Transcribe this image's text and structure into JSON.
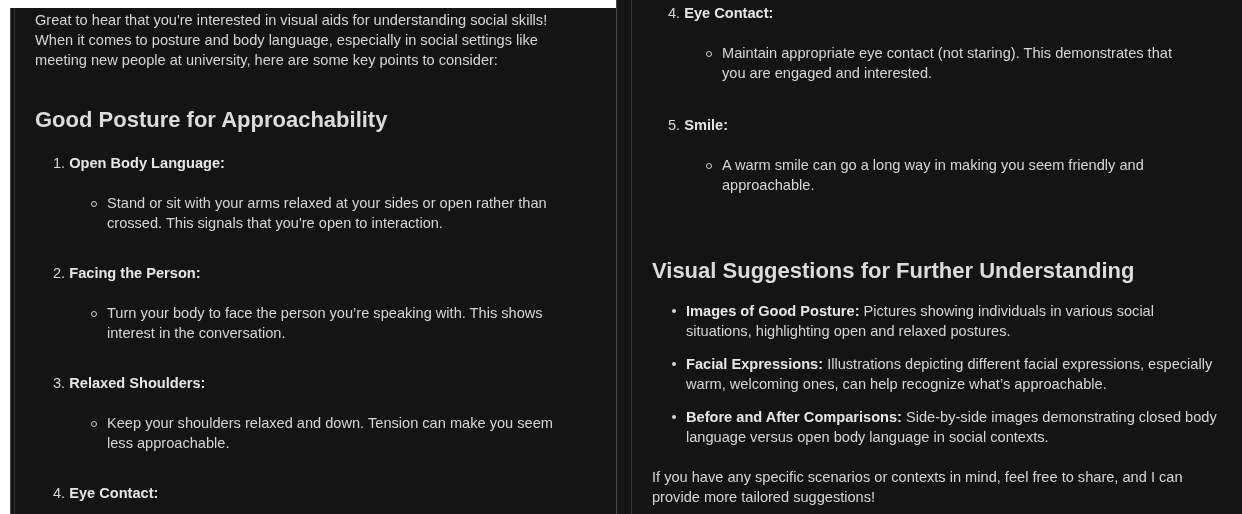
{
  "left_panel": {
    "intro": "Great to hear that you're interested in visual aids for understanding social skills! When it comes to posture and body language, especially in social settings like meeting new people at university, here are some key points to consider:",
    "heading": "Good Posture for Approachability",
    "items": [
      {
        "title": "1. **Open Body Language:**",
        "bullets": [
          "Stand or sit with your arms relaxed at your sides or open rather than crossed. This signals that you're open to interaction."
        ]
      },
      {
        "title": "2. **Facing the Person:**",
        "bullets": [
          "Turn your body to face the person you’re speaking with. This shows interest in the conversation."
        ]
      },
      {
        "title": "3. **Relaxed Shoulders:**",
        "bullets": [
          "Keep your shoulders relaxed and down. Tension can make you seem less approachable."
        ]
      },
      {
        "title": "4. **Eye Contact:**"
      }
    ]
  },
  "right_panel": {
    "items": [
      {
        "title": "4. **Eye Contact:**",
        "bullets": [
          "Maintain appropriate eye contact (not staring). This demonstrates that you are engaged and interested."
        ]
      },
      {
        "title": "5. **Smile:**",
        "bullets": [
          "A warm smile can go a long way in making you seem friendly and approachable."
        ]
      }
    ],
    "heading": "Visual Suggestions for Further Understanding",
    "suggestions": [
      "**Images of Good Posture:** Pictures showing individuals in various social situations, highlighting open and relaxed postures.",
      "**Facial Expressions:** Illustrations depicting different facial expressions, especially warm, welcoming ones, can help recognize what’s approachable.",
      "**Before and After Comparisons:** Side-by-side images demonstrating closed body language versus open body language in social contexts."
    ],
    "closing": "If you have any specific scenarios or contexts in mind, feel free to share, and I can provide more tailored suggestions!"
  }
}
